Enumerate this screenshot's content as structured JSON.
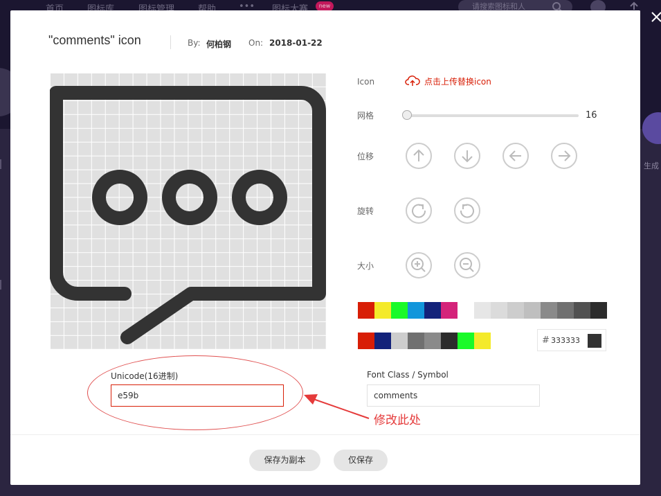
{
  "background": {
    "nav": [
      "首页",
      "图标库",
      "图标管理",
      "帮助",
      "•••",
      "图标大赛"
    ],
    "badge": "new",
    "search_placeholder": "请搜索图标和人",
    "side_text": "生成"
  },
  "modal": {
    "title": "\"comments\"  icon",
    "by_label": "By:",
    "author": "何柏钢",
    "on_label": "On:",
    "date": "2018-01-22",
    "icon_label": "Icon",
    "upload_label": "点击上传替换icon",
    "grid_label": "网格",
    "grid_value": "16",
    "grid_fraction": 0.0,
    "move_label": "位移",
    "rotate_label": "旋转",
    "size_label": "大小",
    "palette_row1": [
      "#d81e06",
      "#f4ea2a",
      "#1afa29",
      "#1296db",
      "#13227a",
      "#d4237a",
      "#ffffff",
      "#e6e6e6",
      "#dbdbdb",
      "#cdcdcd",
      "#bfbfbf",
      "#8a8a8a",
      "#707070",
      "#515151",
      "#2c2c2c"
    ],
    "palette_row2": [
      "#d81e06",
      "#13227a",
      "#cdcdcd",
      "#707070",
      "#8a8a8a",
      "#2c2c2c",
      "#1afa29",
      "#f4ea2a"
    ],
    "color_hash": "#",
    "color_value": "333333",
    "icon_color": "#333333",
    "unicode_label": "Unicode(16进制)",
    "unicode_value": "e59b",
    "fontclass_label": "Font Class / Symbol",
    "fontclass_value": "comments",
    "annotation": "修改此处",
    "save_copy_label": "保存为副本",
    "save_label": "仅保存"
  }
}
